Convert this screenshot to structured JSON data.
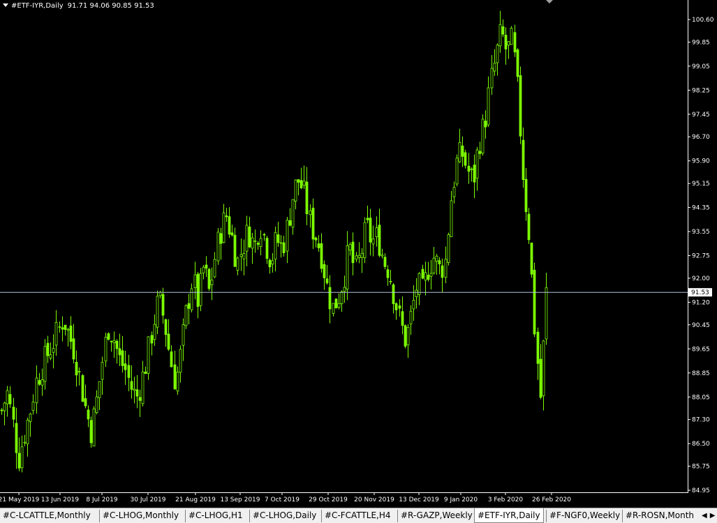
{
  "header": {
    "symbol": "#ETF-IYR,Daily",
    "ohlc": "91.71 94.06 90.85 91.53"
  },
  "colors": {
    "background": "#000000",
    "candle": "#7CFC00",
    "axis_text": "#ffffff",
    "price_line": "#b0c4de"
  },
  "chart_data": {
    "type": "candlestick",
    "y_ticks": [
      "100.60",
      "99.85",
      "99.05",
      "98.25",
      "97.45",
      "96.70",
      "95.90",
      "95.15",
      "94.35",
      "93.55",
      "92.75",
      "92.00",
      "91.20",
      "90.45",
      "89.65",
      "88.85",
      "88.05",
      "87.30",
      "86.50",
      "85.75",
      "84.95"
    ],
    "ylim": [
      84.95,
      100.6
    ],
    "x_ticks": [
      "21 May 2019",
      "13 Jun 2019",
      "8 Jul 2019",
      "30 Jul 2019",
      "21 Aug 2019",
      "13 Sep 2019",
      "7 Oct 2019",
      "29 Oct 2019",
      "20 Nov 2019",
      "13 Dec 2019",
      "9 Jan 2020",
      "3 Feb 2020",
      "26 Feb 2020"
    ],
    "current_price": "91.53",
    "close_path": [
      87.6,
      88.2,
      87.2,
      86.0,
      86.8,
      87.5,
      88.5,
      89.0,
      89.4,
      89.8,
      90.2,
      90.7,
      90.1,
      89.6,
      88.6,
      87.6,
      86.9,
      88.0,
      89.3,
      90.4,
      90.0,
      89.3,
      89.0,
      88.4,
      88.0,
      88.6,
      89.4,
      90.5,
      91.3,
      90.6,
      89.4,
      88.5,
      89.6,
      91.0,
      92.0,
      91.2,
      92.4,
      91.5,
      92.7,
      93.6,
      94.1,
      93.4,
      92.5,
      93.1,
      93.6,
      93.0,
      93.9,
      93.2,
      92.6,
      93.3,
      93.0,
      93.8,
      94.9,
      95.3,
      94.7,
      93.8,
      93.4,
      92.8,
      91.7,
      91.0,
      91.4,
      92.1,
      93.0,
      92.2,
      92.8,
      93.7,
      93.2,
      93.4,
      92.6,
      92.3,
      91.4,
      90.5,
      89.9,
      90.8,
      91.8,
      91.5,
      92.4,
      92.7,
      92.3,
      92.5,
      94.6,
      95.8,
      96.2,
      95.6,
      95.2,
      96.5,
      97.1,
      98.4,
      99.3,
      100.2,
      99.5,
      99.9,
      98.0,
      95.2,
      93.4,
      90.2,
      88.0,
      91.5
    ]
  },
  "tabs": [
    {
      "label": "#C-LCATTLE,Monthly",
      "active": false
    },
    {
      "label": "#C-LHOG,Monthly",
      "active": false
    },
    {
      "label": "#C-LHOG,H1",
      "active": false
    },
    {
      "label": "#C-LHOG,Daily",
      "active": false
    },
    {
      "label": "#C-FCATTLE,H4",
      "active": false
    },
    {
      "label": "#R-GAZP,Weekly",
      "active": false
    },
    {
      "label": "#ETF-IYR,Daily",
      "active": true
    },
    {
      "label": "#F-NGF0,Weekly",
      "active": false
    },
    {
      "label": "#R-ROSN,Month",
      "active": false
    }
  ]
}
